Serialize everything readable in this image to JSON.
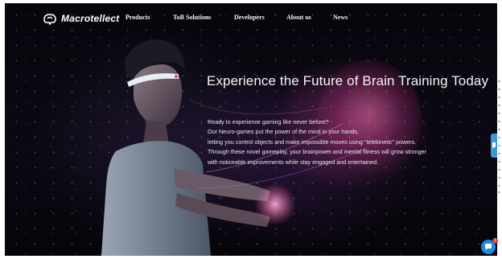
{
  "brand": {
    "name": "Macrotellect"
  },
  "nav": {
    "items": [
      {
        "label": "Products"
      },
      {
        "label": "ToB Solutions"
      },
      {
        "label": "Developers"
      },
      {
        "label": "About us"
      },
      {
        "label": "News"
      }
    ]
  },
  "hero": {
    "headline": "Experience the Future of Brain Training Today",
    "body": [
      "Ready to experience gaming like never before?",
      "Our Neuro-games put the power of the mind in your hands,",
      "letting you control objects and make impossible moves using \"telekinetic\" powers.",
      "Through these novel gameplay, your brainpower and mental fitness will grow stronger",
      "with noticeable improvements while stay engaged and entertained."
    ]
  },
  "widgets": {
    "chat_icon": "chat-bubble-icon",
    "chat_badge": "1",
    "side_tab_icon": "feedback-icon"
  },
  "colors": {
    "background": "#05040a",
    "text": "#f4f4f6",
    "accent_pink": "#d0509a",
    "chat_blue": "#1f8ae6",
    "badge_red": "#e8352e"
  }
}
